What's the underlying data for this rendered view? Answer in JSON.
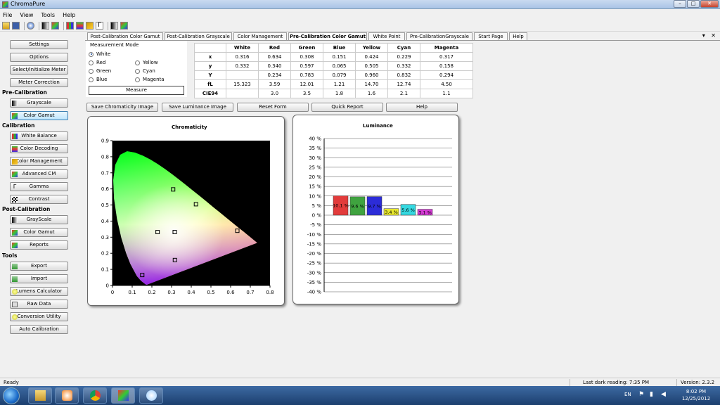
{
  "window": {
    "title": "ChromaPure"
  },
  "window_controls": {
    "minimize": "–",
    "maximize": "□",
    "close": "✕"
  },
  "menu": [
    "File",
    "View",
    "Tools",
    "Help"
  ],
  "sidebar": {
    "buttons": {
      "settings": "Settings",
      "options": "Options",
      "select_meter": "Select/Initialize Meter",
      "meter_correction": "Meter Correction",
      "pre_grayscale": "Grayscale",
      "pre_color_gamut": "Color Gamut",
      "white_balance": "White Balance",
      "color_decoding": "Color Decoding",
      "color_management": "Color Management",
      "advanced_cm": "Advanced CM",
      "gamma": "Gamma",
      "contrast": "Contrast",
      "post_grayscale": "GrayScale",
      "post_color_gamut": "Color Gamut",
      "reports": "Reports",
      "export": "Export",
      "import": "Import",
      "lumens_calculator": "Lumens Calculator",
      "raw_data": "Raw Data",
      "conversion_utility": "Conversion Utility",
      "auto_calibration": "Auto Calibration"
    },
    "sections": {
      "pre_calibration": "Pre-Calibration",
      "calibration": "Calibration",
      "post_calibration": "Post-Calibration",
      "tools": "Tools"
    }
  },
  "tabs": [
    "Post-Calibration Color Gamut",
    "Post-Calibration Grayscale",
    "Color Management",
    "Pre-Calibration Color Gamut",
    "White Point",
    "Pre-CalibrationGrayscale",
    "Start Page",
    "Help"
  ],
  "active_tab": "Pre-Calibration Color Gamut",
  "tab_controls": {
    "dropdown": "▾",
    "close": "✕"
  },
  "measurement_mode": {
    "label": "Measurement Mode",
    "options": [
      "White",
      "Red",
      "Green",
      "Blue",
      "Yellow",
      "Cyan",
      "Magenta"
    ],
    "selected": "White",
    "measure_button": "Measure"
  },
  "table": {
    "headers": [
      "",
      "White",
      "Red",
      "Green",
      "Blue",
      "Yellow",
      "Cyan",
      "Magenta"
    ],
    "rows": [
      [
        "x",
        "0.316",
        "0.634",
        "0.308",
        "0.151",
        "0.424",
        "0.229",
        "0.317"
      ],
      [
        "y",
        "0.332",
        "0.340",
        "0.597",
        "0.065",
        "0.505",
        "0.332",
        "0.158"
      ],
      [
        "Y",
        "",
        "0.234",
        "0.783",
        "0.079",
        "0.960",
        "0.832",
        "0.294"
      ],
      [
        "fL",
        "15.323",
        "3.59",
        "12.01",
        "1.21",
        "14.70",
        "12.74",
        "4.50"
      ],
      [
        "CIE94",
        "",
        "3.0",
        "3.5",
        "1.8",
        "1.6",
        "2.1",
        "1.1"
      ]
    ]
  },
  "actions": {
    "save_chromaticity": "Save Chromaticity Image",
    "save_luminance": "Save Luminance Image",
    "reset_form": "Reset Form",
    "quick_report": "Quick Report",
    "help": "Help"
  },
  "chart_data": [
    {
      "type": "scatter",
      "title": "Chromaticity",
      "xlim": [
        0,
        0.8
      ],
      "ylim": [
        0,
        0.9
      ],
      "x_ticks": [
        "0",
        "0.1",
        "0.2",
        "0.3",
        "0.4",
        "0.5",
        "0.6",
        "0.7",
        "0.8"
      ],
      "y_ticks": [
        "0",
        "0.1",
        "0.2",
        "0.3",
        "0.4",
        "0.5",
        "0.6",
        "0.7",
        "0.8",
        "0.9"
      ],
      "background": "#000000",
      "points": [
        {
          "x": 0.316,
          "y": 0.332,
          "marker": "hollow-square"
        },
        {
          "x": 0.634,
          "y": 0.34,
          "marker": "hollow-square"
        },
        {
          "x": 0.308,
          "y": 0.597,
          "marker": "hollow-square"
        },
        {
          "x": 0.151,
          "y": 0.065,
          "marker": "hollow-square"
        },
        {
          "x": 0.424,
          "y": 0.505,
          "marker": "hollow-square"
        },
        {
          "x": 0.229,
          "y": 0.332,
          "marker": "hollow-square"
        },
        {
          "x": 0.317,
          "y": 0.158,
          "marker": "hollow-square"
        }
      ]
    },
    {
      "type": "bar",
      "title": "Luminance",
      "ylim": [
        -40,
        40
      ],
      "y_ticks": [
        "40 %",
        "35 %",
        "30 %",
        "25 %",
        "20 %",
        "15 %",
        "10 %",
        "5 %",
        "0 %",
        "-5 %",
        "-10 %",
        "-15 %",
        "-20 %",
        "-25 %",
        "-30 %",
        "-35 %",
        "-40 %"
      ],
      "grid": true,
      "values": [
        10.1,
        9.6,
        9.7,
        3.4,
        5.6,
        3.1
      ],
      "labels": [
        "10.1 %",
        "9.6 %",
        "9.7 %",
        "3.4 %",
        "5.6 %",
        "3.1 %"
      ],
      "colors": [
        "#e23b3b",
        "#3fa33f",
        "#2c2cd8",
        "#e8e82e",
        "#35d8e0",
        "#d43ad4"
      ]
    }
  ],
  "status": {
    "ready": "Ready",
    "last_dark": "Last dark reading:  7:35 PM",
    "version": "Version: 2.3.2"
  },
  "taskbar": {
    "lang": "EN",
    "time": "8:02 PM",
    "date": "12/25/2012"
  },
  "colors": {
    "titlebar": "#b7cde9",
    "taskbar": "#2a4f80",
    "plot_bg": "#000000"
  }
}
